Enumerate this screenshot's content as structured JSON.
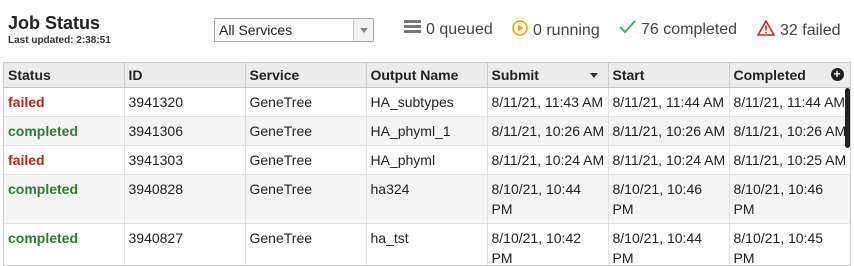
{
  "header": {
    "title": "Job Status",
    "last_updated": "Last updated: 2:38:51",
    "service_filter": "All Services",
    "stats": {
      "queued": "0 queued",
      "running": "0 running",
      "completed": "76 completed",
      "failed": "32 failed"
    }
  },
  "table": {
    "columns": [
      "Status",
      "ID",
      "Service",
      "Output Name",
      "Submit",
      "Start",
      "Completed"
    ],
    "rows": [
      {
        "status": "failed",
        "id": "3941320",
        "service": "GeneTree",
        "output": "HA_subtypes",
        "submit": "8/11/21, 11:43 AM",
        "start": "8/11/21, 11:44 AM",
        "completed": "8/11/21, 11:44 AM"
      },
      {
        "status": "completed",
        "id": "3941306",
        "service": "GeneTree",
        "output": "HA_phyml_1",
        "submit": "8/11/21, 10:26 AM",
        "start": "8/11/21, 10:26 AM",
        "completed": "8/11/21, 10:26 AM"
      },
      {
        "status": "failed",
        "id": "3941303",
        "service": "GeneTree",
        "output": "HA_phyml",
        "submit": "8/11/21, 10:24 AM",
        "start": "8/11/21, 10:24 AM",
        "completed": "8/11/21, 10:25 AM"
      },
      {
        "status": "completed",
        "id": "3940828",
        "service": "GeneTree",
        "output": "ha324",
        "submit": "8/10/21, 10:44 PM",
        "start": "8/10/21, 10:46 PM",
        "completed": "8/10/21, 10:46 PM"
      },
      {
        "status": "completed",
        "id": "3940827",
        "service": "GeneTree",
        "output": "ha_tst",
        "submit": "8/10/21, 10:42 PM",
        "start": "8/10/21, 10:44 PM",
        "completed": "8/10/21, 10:45 PM"
      }
    ]
  },
  "colors": {
    "failed": "#b3261e",
    "completed": "#2e7d32",
    "running_icon": "#f0a500",
    "completed_icon": "#4caf50",
    "failed_icon": "#c62828"
  },
  "icons": {
    "queued": "list-icon",
    "running": "play-circle-icon",
    "completed": "checkmark-icon",
    "failed": "warning-triangle-icon",
    "add_column": "plus-circle-icon"
  }
}
